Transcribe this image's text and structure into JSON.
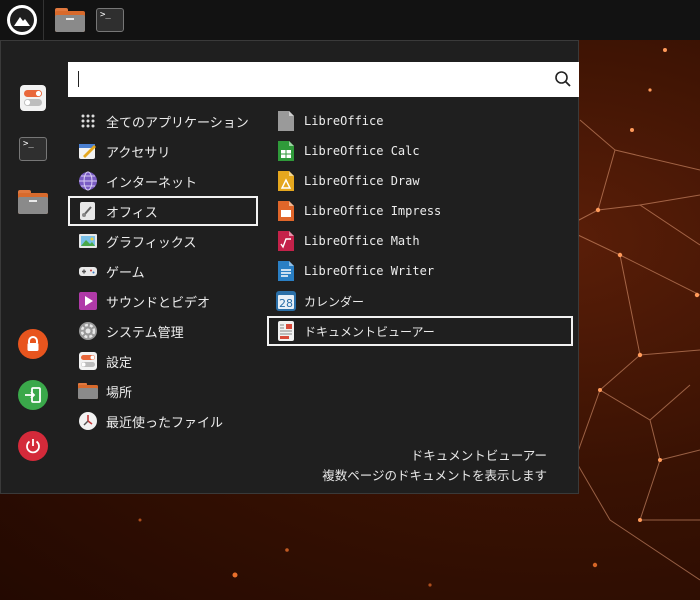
{
  "panel": {
    "tasks": [
      {
        "icon": "folder-icon"
      },
      {
        "icon": "terminal-icon",
        "glyph": ">_"
      }
    ]
  },
  "search": {
    "value": "",
    "placeholder": ""
  },
  "categories": [
    {
      "label": "全てのアプリケーション",
      "icon": "grid-icon"
    },
    {
      "label": "アクセサリ",
      "icon": "accessories-icon"
    },
    {
      "label": "インターネット",
      "icon": "internet-icon"
    },
    {
      "label": "オフィス",
      "icon": "office-icon",
      "selected": true
    },
    {
      "label": "グラフィックス",
      "icon": "graphics-icon"
    },
    {
      "label": "ゲーム",
      "icon": "games-icon"
    },
    {
      "label": "サウンドとビデオ",
      "icon": "multimedia-icon"
    },
    {
      "label": "システム管理",
      "icon": "system-icon"
    },
    {
      "label": "設定",
      "icon": "settings-icon"
    },
    {
      "label": "場所",
      "icon": "places-folder-icon"
    },
    {
      "label": "最近使ったファイル",
      "icon": "recent-files-icon"
    }
  ],
  "apps": [
    {
      "label": "LibreOffice",
      "icon": "libreoffice-icon",
      "color": "#9a9a9a"
    },
    {
      "label": "LibreOffice Calc",
      "icon": "libreoffice-calc-icon",
      "color": "#2f9a3a"
    },
    {
      "label": "LibreOffice Draw",
      "icon": "libreoffice-draw-icon",
      "color": "#e5a71e"
    },
    {
      "label": "LibreOffice Impress",
      "icon": "libreoffice-impress-icon",
      "color": "#e0662a"
    },
    {
      "label": "LibreOffice Math",
      "icon": "libreoffice-math-icon",
      "color": "#c4224a"
    },
    {
      "label": "LibreOffice Writer",
      "icon": "libreoffice-writer-icon",
      "color": "#2a7fc4"
    },
    {
      "label": "カレンダー",
      "icon": "calendar-icon",
      "glyph": "28",
      "color": "#2a6fa8"
    },
    {
      "label": "ドキュメントビューアー",
      "icon": "document-viewer-icon",
      "selected": true
    }
  ],
  "description": {
    "title": "ドキュメントビューアー",
    "text": "複数ページのドキュメントを表示します"
  },
  "sidebar": [
    {
      "icon": "settings-toggle-icon"
    },
    {
      "icon": "terminal-icon",
      "glyph": ">_"
    },
    {
      "icon": "folder-icon"
    },
    {
      "icon": "lock-icon",
      "color": "#e8551e"
    },
    {
      "icon": "logout-icon",
      "color": "#3aa84a"
    },
    {
      "icon": "power-icon",
      "color": "#d42a3a"
    }
  ]
}
